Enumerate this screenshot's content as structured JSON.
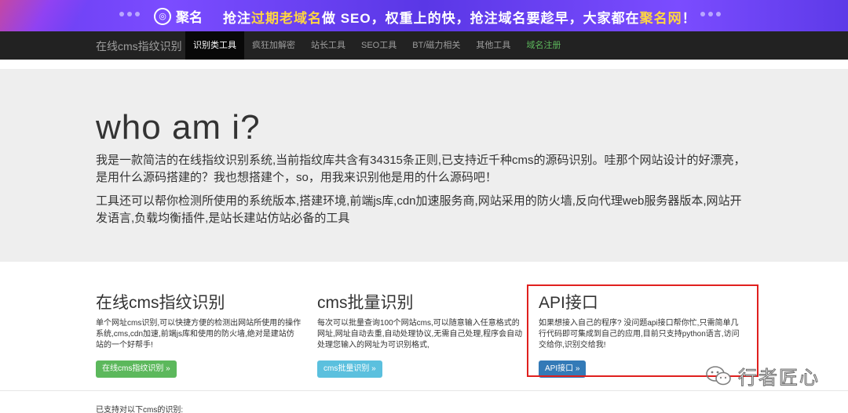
{
  "banner": {
    "logo_mark": "◎",
    "logo_text": "聚名",
    "slogan_part1": "抢注",
    "slogan_hl1": "过期老域名",
    "slogan_part2": "做 SEO，权重上的快，抢注域名要趁早，大家都在",
    "slogan_hl2": "聚名网",
    "slogan_end": "！"
  },
  "navbar": {
    "brand": "在线cms指纹识别",
    "items": [
      {
        "label": "识别类工具"
      },
      {
        "label": "疯狂加解密"
      },
      {
        "label": "站长工具"
      },
      {
        "label": "SEO工具"
      },
      {
        "label": "BT/磁力相关"
      },
      {
        "label": "其他工具"
      },
      {
        "label": "域名注册"
      }
    ]
  },
  "jumbotron": {
    "heading": "who am i?",
    "p1": "我是一款简洁的在线指纹识别系统,当前指纹库共含有34315条正则,已支持近千种cms的源码识别。哇那个网站设计的好漂亮，是用什么源码搭建的？我也想搭建个，so，用我来识别他是用的什么源码吧！",
    "p2": "工具还可以帮你检测所使用的系统版本,搭建环境,前端js库,cdn加速服务商,网站采用的防火墙,反向代理web服务器版本,网站开发语言,负载均衡插件,是站长建站仿站必备的工具"
  },
  "features": [
    {
      "title": "在线cms指纹识别",
      "desc": "单个网址cms识别,可以快捷方便的检测出网站所使用的操作系统,cms,cdn加速,前端js库和使用的防火墙,绝对是建站仿站的一个好帮手!",
      "button": "在线cms指纹识别 »"
    },
    {
      "title": "cms批量识别",
      "desc": "每次可以批量查询100个网站cms,可以随意输入任意格式的网址,网址自动去重,自动处理协议,无需自己处理,程序会自动处理您输入的网址为可识别格式,",
      "button": "cms批量识别 »"
    },
    {
      "title": "API接口",
      "desc": "如果想接入自己的程序? 没问题api接口帮你忙,只需简单几行代码即可集成到自己的应用,目前只支持python语言,访问交给你,识别交给我!",
      "button": "API接口 »"
    }
  ],
  "supported_text": "已支持对以下cms的识别:",
  "watermark": "行者匠心",
  "colors": {
    "banner": "#6a3cf0",
    "navbar": "#222222",
    "jumbotron": "#eeeeee",
    "btn_green": "#5cb85c",
    "btn_cyan": "#5bc0de",
    "btn_blue": "#337ab7",
    "highlight_box": "#e0201e"
  }
}
